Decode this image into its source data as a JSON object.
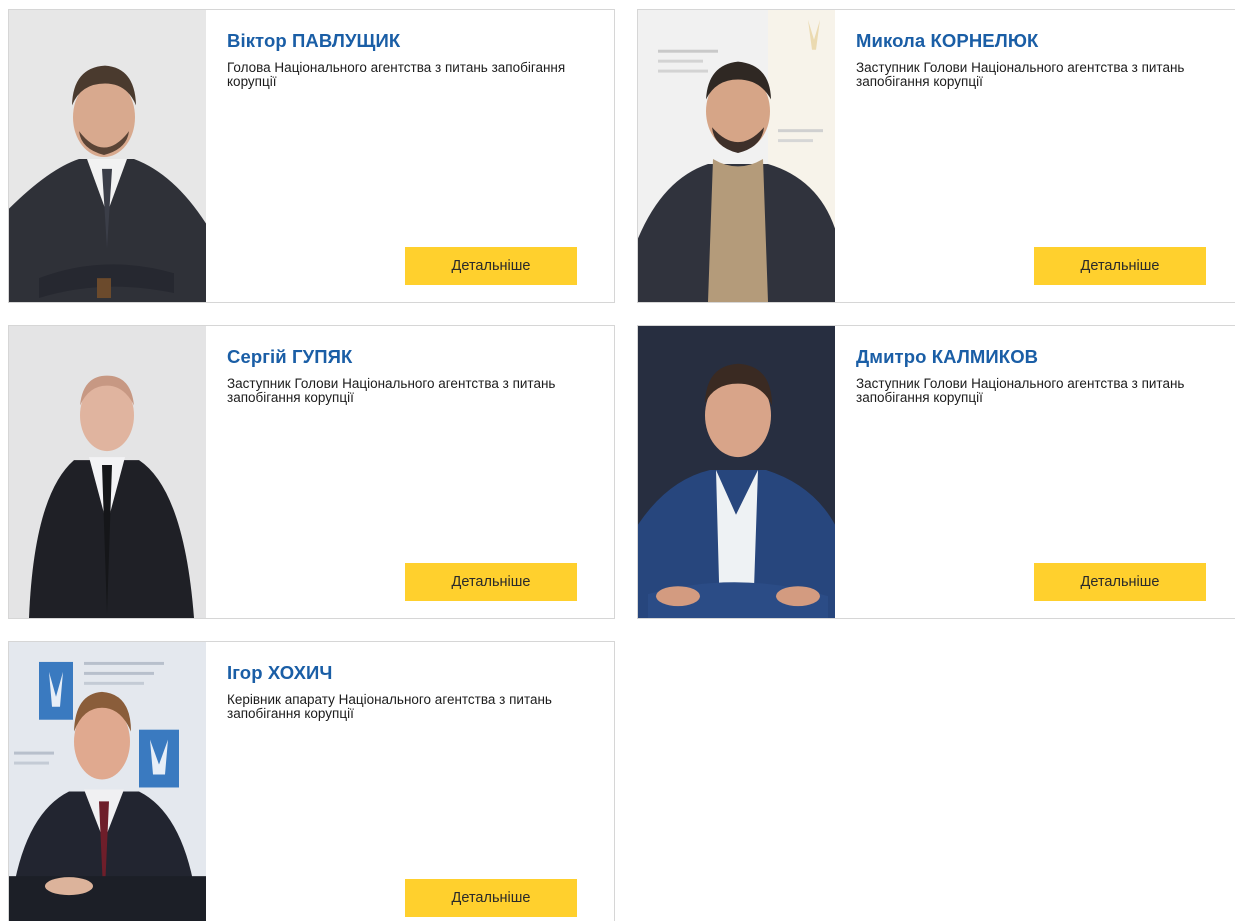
{
  "button_label": "Детальніше",
  "accent_color": "#1a5ea6",
  "button_color": "#ffd02d",
  "people": [
    {
      "name": "Віктор ПАВЛУЩИК",
      "position": "Голова Національного агентства з питань запобігання корупції"
    },
    {
      "name": "Микола КОРНЕЛЮК",
      "position": "Заступник Голови Національного агентства з питань запобігання корупції"
    },
    {
      "name": "Сергій ГУПЯК",
      "position": "Заступник Голови Національного агентства з питань запобігання корупції"
    },
    {
      "name": "Дмитро КАЛМИКОВ",
      "position": "Заступник Голови Національного агентства з питань запобігання корупції"
    },
    {
      "name": "Ігор ХОХИЧ",
      "position": "Керівник апарату Національного агентства з питань запобігання корупції"
    }
  ]
}
